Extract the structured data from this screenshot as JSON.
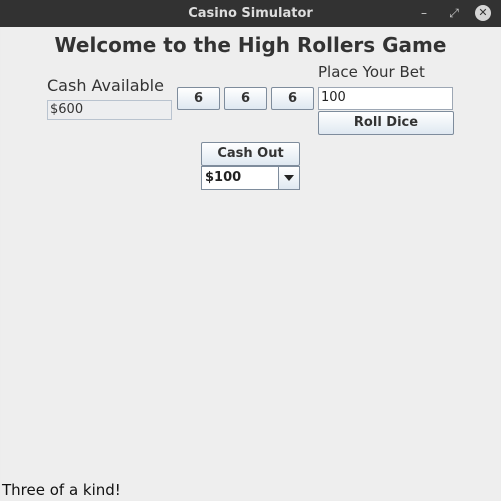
{
  "window": {
    "title": "Casino Simulator",
    "minimize_glyph": "–",
    "maximize_glyph": "⤢",
    "close_glyph": "✕"
  },
  "game": {
    "heading": "Welcome to the High Rollers Game",
    "cash_label": "Cash Available",
    "cash_value": "$600",
    "dice": [
      "6",
      "6",
      "6"
    ],
    "bet_label": "Place Your Bet",
    "bet_value": "100",
    "roll_label": "Roll Dice",
    "cash_out_label": "Cash Out",
    "cash_out_selected": "$100",
    "status": "Three of a kind!"
  }
}
